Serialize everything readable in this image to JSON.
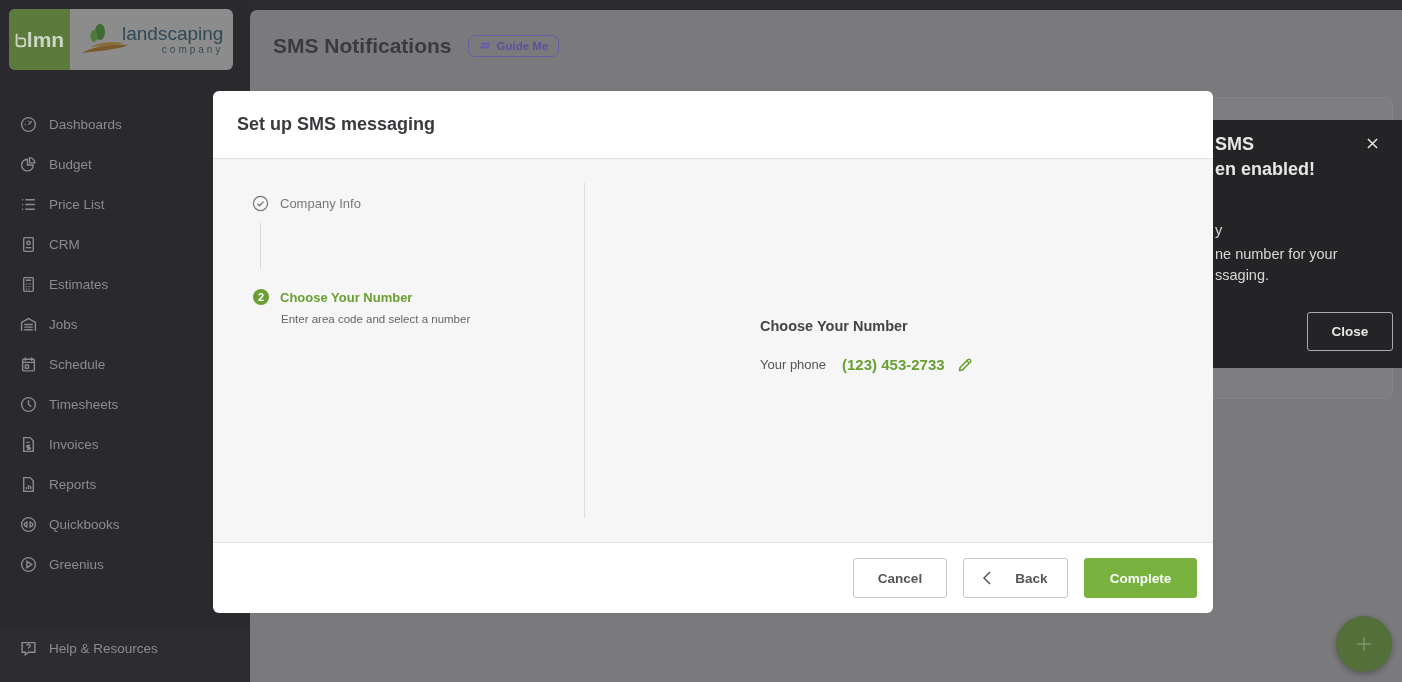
{
  "logo": {
    "badge": "lmn",
    "name": "landscaping",
    "tagline": "company"
  },
  "sidebar": {
    "items": [
      {
        "label": "Dashboards"
      },
      {
        "label": "Budget"
      },
      {
        "label": "Price List"
      },
      {
        "label": "CRM"
      },
      {
        "label": "Estimates"
      },
      {
        "label": "Jobs"
      },
      {
        "label": "Schedule"
      },
      {
        "label": "Timesheets"
      },
      {
        "label": "Invoices"
      },
      {
        "label": "Reports"
      },
      {
        "label": "Quickbooks"
      },
      {
        "label": "Greenius"
      }
    ],
    "footer_items": [
      {
        "label": "Help & Resources"
      }
    ]
  },
  "page": {
    "title": "SMS Notifications",
    "guide_button": "Guide Me"
  },
  "toast": {
    "title_lines": [
      "SMS",
      "en enabled!"
    ],
    "body_lines": [
      "y",
      "ne number for your",
      "ssaging."
    ],
    "close_button": "Close"
  },
  "modal": {
    "title": "Set up SMS messaging",
    "steps": [
      {
        "kind": "done",
        "label": "Company Info"
      },
      {
        "kind": "active",
        "number": "2",
        "label": "Choose Your Number",
        "description": "Enter area code and select a number"
      }
    ],
    "panel": {
      "heading": "Choose Your Number",
      "phone_label": "Your phone",
      "phone_value": "(123) 453-2733"
    },
    "buttons": {
      "cancel": "Cancel",
      "back": "Back",
      "complete": "Complete"
    }
  }
}
